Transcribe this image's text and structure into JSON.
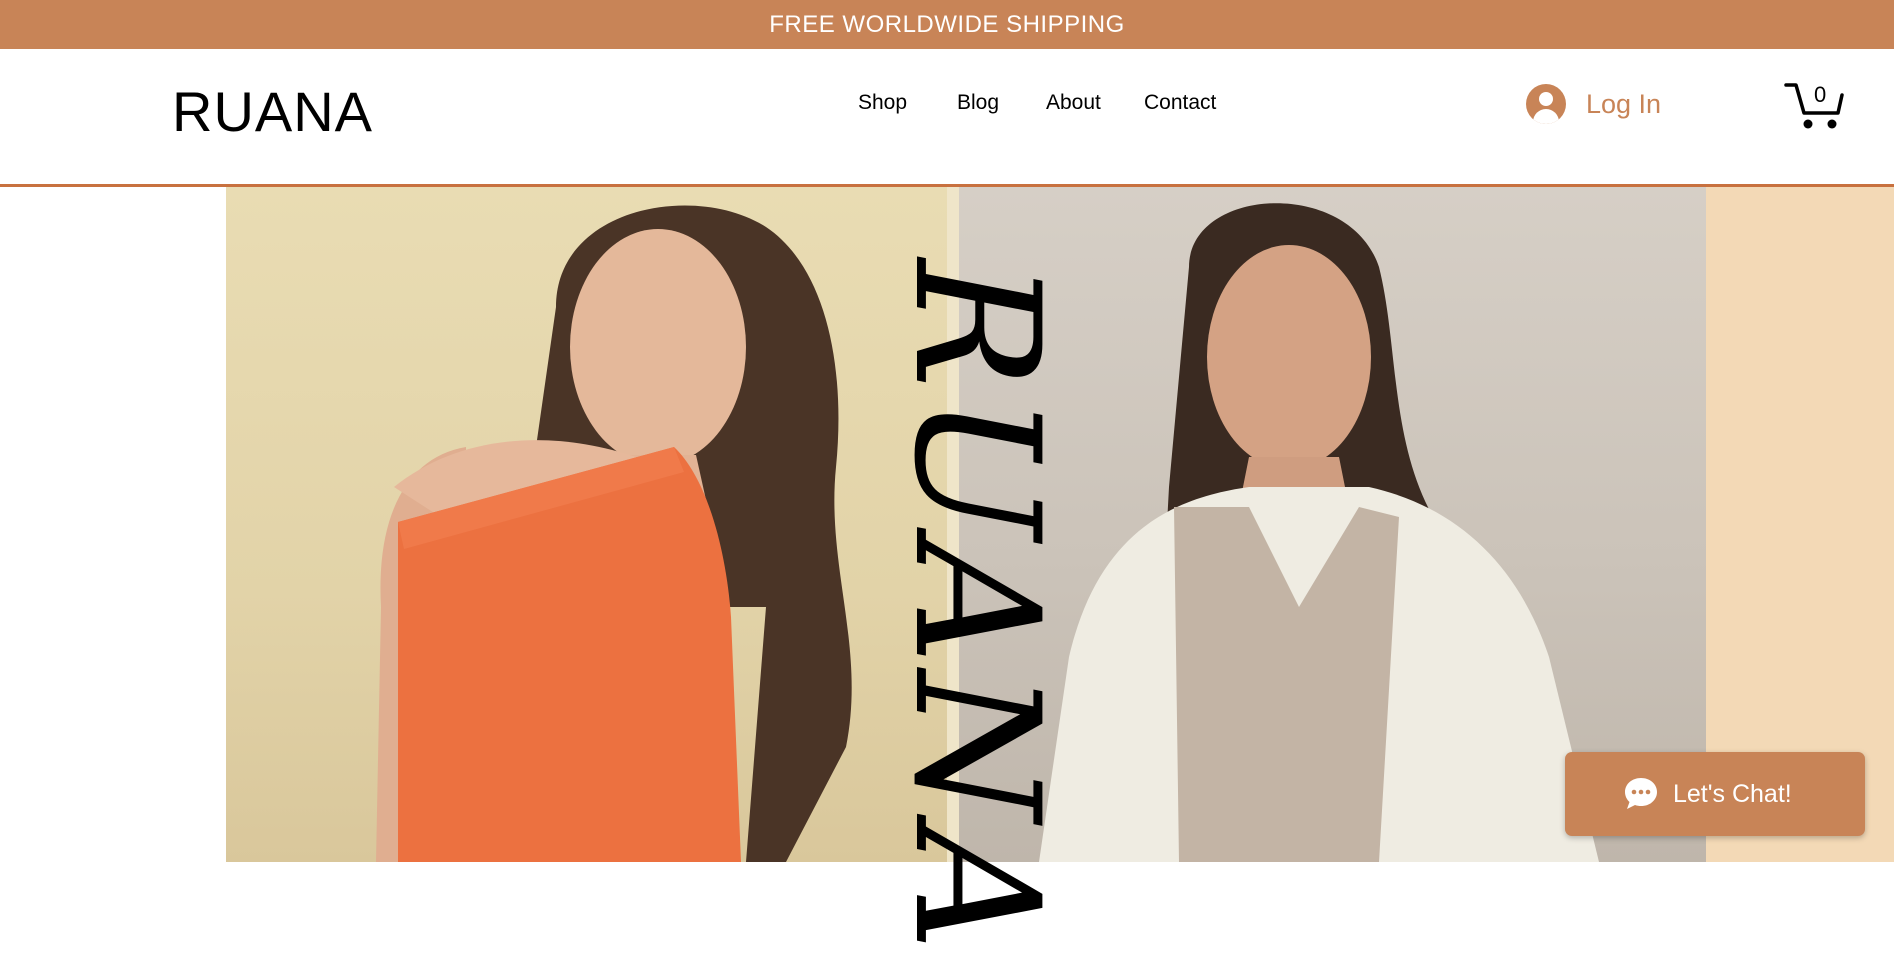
{
  "banner": {
    "text": "FREE WORLDWIDE SHIPPING"
  },
  "header": {
    "logo": "RUANA",
    "nav": [
      "Shop",
      "Blog",
      "About",
      "Contact"
    ],
    "login_label": "Log In",
    "cart_count": "0"
  },
  "hero": {
    "vertical_text": "RUANA"
  },
  "chat": {
    "label": "Let's Chat!"
  },
  "colors": {
    "accent": "#c88457",
    "header_border": "#c8713f",
    "peach_panel": "#f3d9b6"
  },
  "icons": [
    "user-avatar-icon",
    "cart-icon",
    "chat-bubble-icon"
  ]
}
